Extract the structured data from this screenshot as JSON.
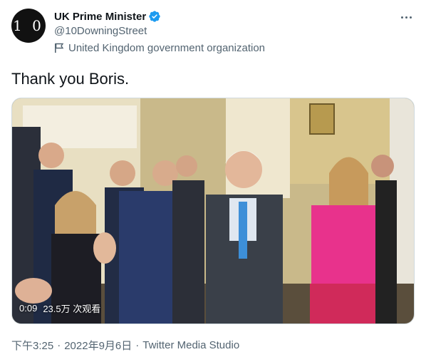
{
  "account": {
    "avatar_text": "1 0",
    "display_name": "UK Prime Minister",
    "handle": "@10DowningStreet",
    "affiliation": "United Kingdom government organization",
    "verified_color": "#1d9bf0"
  },
  "tweet": {
    "text": "Thank you Boris."
  },
  "video": {
    "duration": "0:09",
    "views": "23.5万 次观看"
  },
  "meta": {
    "time": "下午3:25",
    "separator": "·",
    "date": "2022年9月6日",
    "source": "Twitter Media Studio"
  },
  "icons": {
    "verified": "verified-badge-icon",
    "affiliation": "flag-icon",
    "more": "more-options-icon"
  }
}
